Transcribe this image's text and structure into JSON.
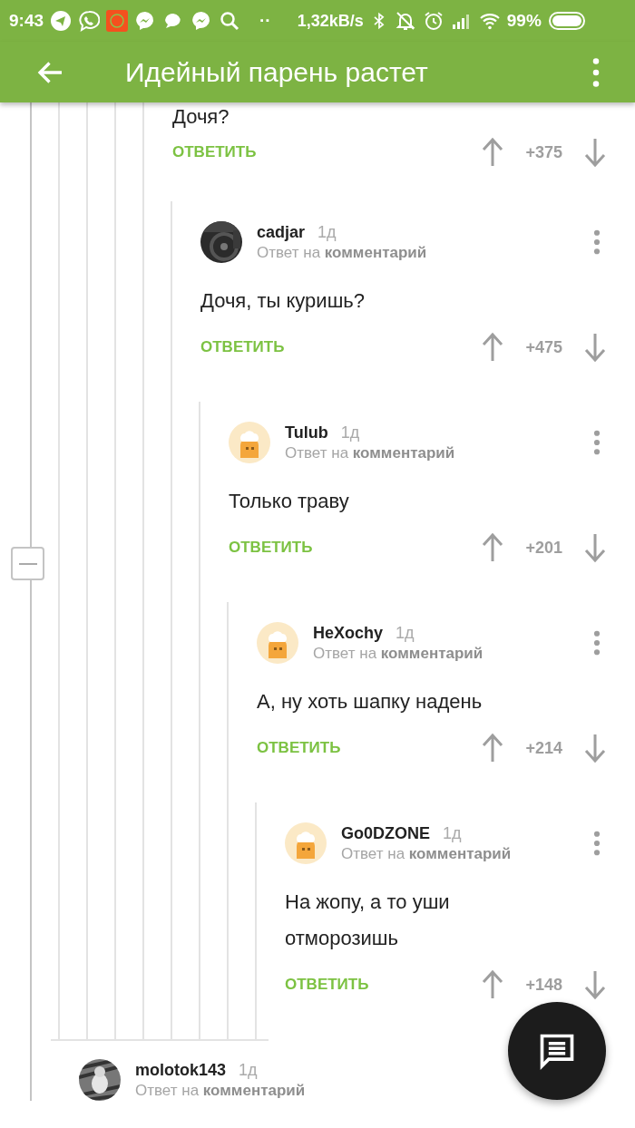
{
  "status_bar": {
    "time": "9:43",
    "more_notifications": "··",
    "speed": "1,32kB/s",
    "battery": "99%"
  },
  "app_bar": {
    "title": "Идейный парень растет"
  },
  "comments": [
    {
      "text": "Дочя?",
      "reply_label": "ОТВЕТИТЬ",
      "score": "+375",
      "children": [
        {
          "author": "cadjar",
          "time": "1д",
          "reply_to": "Ответ на **комментарий**",
          "text": "Дочя, ты куришь?",
          "reply_label": "ОТВЕТИТЬ",
          "score": "+475",
          "children": [
            {
              "author": "Tulub",
              "avatar": {
                "kind": "default"
              },
              "time": "1д",
              "reply_to": "Ответ на **комментарий**",
              "text": "Только траву",
              "reply_label": "ОТВЕТИТЬ",
              "score": "+201",
              "children": [
                {
                  "author": "HeXochy",
                  "avatar": {
                    "kind": "default"
                  },
                  "time": "1д",
                  "reply_to": "Ответ на **комментарий**",
                  "text": "А, ну хоть шапку надень",
                  "reply_label": "ОТВЕТИТЬ",
                  "score": "+214",
                  "children": [
                    {
                      "author": "Go0DZONE",
                      "avatar": {
                        "kind": "default"
                      },
                      "time": "1д",
                      "reply_to": "Ответ на **комментарий**",
                      "text": "На жопу, а то уши отморозишь",
                      "reply_label": "ОТВЕТИТЬ",
                      "score": "+148"
                    }
                  ]
                }
              ]
            }
          ]
        }
      ]
    }
  ],
  "next_comment": {
    "author": "molotok143",
    "time": "1д",
    "reply_to": "Ответ на **комментарий**"
  }
}
